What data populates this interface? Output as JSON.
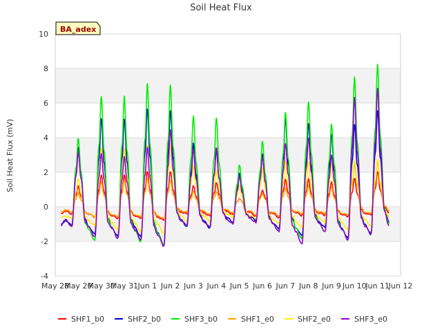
{
  "chart_data": {
    "type": "line",
    "title": "Soil Heat Flux",
    "xlabel": "",
    "ylabel": "Soil Heat Flux (mV)",
    "badge": "BA_adex",
    "ylim": [
      -4,
      10
    ],
    "yticks": [
      -4,
      -2,
      0,
      2,
      4,
      6,
      8,
      10
    ],
    "xlim": [
      0,
      15
    ],
    "xticks": [
      {
        "x": 0,
        "label": "May 28"
      },
      {
        "x": 1,
        "label": "May 29"
      },
      {
        "x": 2,
        "label": "May 30"
      },
      {
        "x": 3,
        "label": "May 31"
      },
      {
        "x": 4,
        "label": "Jun 1"
      },
      {
        "x": 5,
        "label": "Jun 2"
      },
      {
        "x": 6,
        "label": "Jun 3"
      },
      {
        "x": 7,
        "label": "Jun 4"
      },
      {
        "x": 8,
        "label": "Jun 5"
      },
      {
        "x": 9,
        "label": "Jun 6"
      },
      {
        "x": 10,
        "label": "Jun 7"
      },
      {
        "x": 11,
        "label": "Jun 8"
      },
      {
        "x": 12,
        "label": "Jun 9"
      },
      {
        "x": 13,
        "label": "Jun 10"
      },
      {
        "x": 14,
        "label": "Jun 11"
      },
      {
        "x": 15,
        "label": "Jun 12"
      }
    ],
    "grid": "horizontal bands",
    "legend_position": "bottom",
    "x_start": 0.25,
    "x_end": 14.5,
    "day_peak_x": [
      1,
      2,
      3,
      4,
      5,
      6,
      7,
      8,
      9,
      10,
      11,
      12,
      13,
      14
    ],
    "series": [
      {
        "name": "SHF1_b0",
        "color": "#ff0000",
        "base": -0.5,
        "nights": [
          -0.4,
          -0.6,
          -0.7,
          -0.7,
          -0.8,
          -0.4,
          -0.5,
          -0.4,
          -0.5,
          -0.6,
          -0.5,
          -0.5,
          -0.6,
          -0.5,
          -0.3
        ],
        "peaks": [
          1.2,
          1.8,
          1.8,
          2.0,
          2.0,
          1.2,
          1.4,
          0.5,
          1.0,
          1.6,
          1.6,
          1.4,
          1.6,
          2.0
        ]
      },
      {
        "name": "SHF2_b0",
        "color": "#0000cc",
        "base": -1.1,
        "nights": [
          -1.1,
          -1.6,
          -1.7,
          -1.7,
          -2.2,
          -1.1,
          -1.2,
          -0.9,
          -0.8,
          -1.3,
          -1.7,
          -1.2,
          -1.8,
          -1.5,
          -0.9
        ],
        "peaks": [
          3.4,
          5.1,
          5.1,
          5.7,
          5.6,
          3.7,
          3.3,
          1.9,
          3.0,
          5.1,
          4.8,
          4.2,
          4.8,
          5.6
        ]
      },
      {
        "name": "SHF3_b0",
        "color": "#00ee00",
        "base": -1.1,
        "nights": [
          -1.1,
          -1.9,
          -1.8,
          -2.0,
          -2.2,
          -1.1,
          -1.2,
          -1.0,
          -0.9,
          -1.4,
          -1.8,
          -1.4,
          -1.9,
          -1.6,
          -1.0
        ],
        "peaks": [
          4.0,
          6.4,
          6.4,
          7.1,
          7.0,
          5.2,
          5.1,
          2.4,
          3.8,
          5.5,
          6.1,
          4.8,
          7.5,
          8.2
        ]
      },
      {
        "name": "SHF1_e0",
        "color": "#ffa500",
        "base": -0.4,
        "nights": [
          -0.3,
          -0.6,
          -0.6,
          -0.6,
          -0.7,
          -0.3,
          -0.4,
          -0.3,
          -0.4,
          -0.5,
          -0.4,
          -0.4,
          -0.5,
          -0.4,
          -0.2
        ],
        "peaks": [
          0.8,
          1.4,
          1.5,
          1.6,
          1.5,
          0.9,
          0.9,
          0.5,
          0.8,
          1.1,
          1.2,
          1.1,
          2.4,
          2.6
        ]
      },
      {
        "name": "SHF2_e0",
        "color": "#ffee00",
        "base": -0.7,
        "nights": [
          -0.7,
          -1.1,
          -1.3,
          -1.4,
          -1.5,
          -0.8,
          -0.8,
          -0.6,
          -0.7,
          -1.0,
          -1.2,
          -0.9,
          -1.3,
          -1.1,
          -0.6
        ],
        "peaks": [
          1.6,
          3.4,
          3.4,
          3.6,
          3.6,
          2.4,
          2.1,
          1.2,
          2.2,
          2.6,
          2.6,
          2.5,
          2.7,
          2.8
        ]
      },
      {
        "name": "SHF3_e0",
        "color": "#9400d3",
        "base": -1.1,
        "nights": [
          -1.1,
          -1.7,
          -1.8,
          -1.9,
          -2.3,
          -1.1,
          -1.2,
          -1.0,
          -0.9,
          -1.4,
          -2.1,
          -1.4,
          -1.9,
          -1.6,
          -1.1
        ],
        "peaks": [
          3.2,
          3.1,
          2.9,
          3.4,
          4.4,
          3.3,
          3.4,
          1.7,
          2.9,
          3.7,
          4.0,
          3.0,
          6.3,
          6.8
        ]
      }
    ]
  }
}
